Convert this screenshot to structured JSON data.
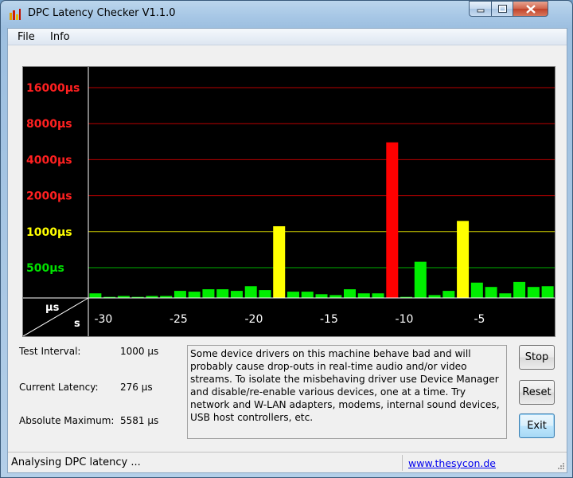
{
  "window": {
    "title": "DPC Latency Checker V1.1.0"
  },
  "menu": {
    "items": [
      "File",
      "Info"
    ]
  },
  "colors": {
    "green": "#00ee00",
    "yellow": "#ffff00",
    "red": "#ff0000",
    "grid_red": "#b80000",
    "grid_yellow": "#c8c800",
    "grid_green": "#00b000"
  },
  "chart_data": {
    "type": "bar",
    "xlabel": "s",
    "ylabel": "µs",
    "ylim": [
      250,
      20000
    ],
    "xlim": [
      -31,
      0
    ],
    "y_scale": "log",
    "y_ticks": [
      {
        "label": "16000µs",
        "value": 16000,
        "color": "#ff2020"
      },
      {
        "label": "8000µs",
        "value": 8000,
        "color": "#ff2020"
      },
      {
        "label": "4000µs",
        "value": 4000,
        "color": "#ff2020"
      },
      {
        "label": "2000µs",
        "value": 2000,
        "color": "#ff2020"
      },
      {
        "label": "1000µs",
        "value": 1000,
        "color": "#ffff00"
      },
      {
        "label": "500µs",
        "value": 500,
        "color": "#00e000"
      }
    ],
    "x_ticks": [
      {
        "label": "-30",
        "value": -30
      },
      {
        "label": "-25",
        "value": -25
      },
      {
        "label": "-20",
        "value": -20
      },
      {
        "label": "-15",
        "value": -15
      },
      {
        "label": "-10",
        "value": -10
      },
      {
        "label": "-5",
        "value": -5
      }
    ],
    "values": [
      305,
      285,
      290,
      285,
      290,
      290,
      320,
      315,
      330,
      330,
      320,
      350,
      325,
      1110,
      315,
      315,
      300,
      295,
      330,
      305,
      305,
      5581,
      285,
      560,
      295,
      320,
      1230,
      375,
      345,
      305,
      380,
      345,
      350
    ]
  },
  "stats": {
    "test_interval": {
      "label": "Test Interval:",
      "value": "1000 µs"
    },
    "current_latency": {
      "label": "Current Latency:",
      "value": "276 µs"
    },
    "absolute_maximum": {
      "label": "Absolute Maximum:",
      "value": "5581 µs"
    }
  },
  "message": "Some device drivers on this machine behave bad and will probably cause drop-outs in real-time audio and/or video streams. To isolate the misbehaving driver use Device Manager and disable/re-enable various devices, one at a time. Try network and W-LAN adapters, modems, internal sound devices, USB host controllers, etc.",
  "buttons": {
    "stop": "Stop",
    "reset": "Reset",
    "exit": "Exit"
  },
  "status": {
    "text": "Analysing DPC latency ...",
    "link": "www.thesycon.de"
  }
}
